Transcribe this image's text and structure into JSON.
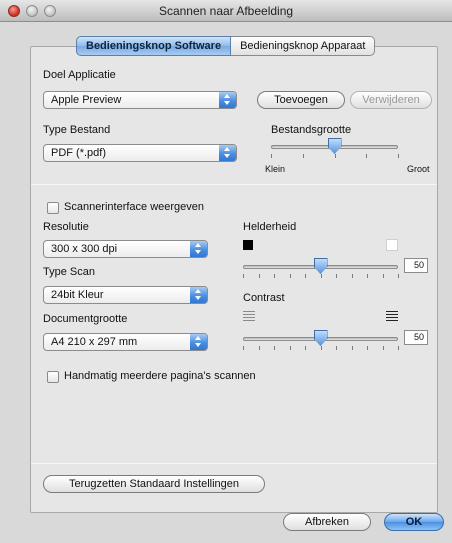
{
  "window": {
    "title": "Scannen naar Afbeelding"
  },
  "tabs": [
    {
      "label": "Bedieningsknop Software",
      "active": true
    },
    {
      "label": "Bedieningsknop Apparaat",
      "active": false
    }
  ],
  "doel": {
    "label": "Doel Applicatie",
    "value": "Apple Preview",
    "add_label": "Toevoegen",
    "remove_label": "Verwijderen"
  },
  "type_bestand": {
    "label": "Type Bestand",
    "value": "PDF (*.pdf)"
  },
  "bestandsgrootte": {
    "label": "Bestandsgrootte",
    "min_label": "Klein",
    "max_label": "Groot",
    "level": 0.5
  },
  "scannerinterface": {
    "label": "Scannerinterface weergeven",
    "checked": false
  },
  "resolutie": {
    "label": "Resolutie",
    "value": "300 x 300 dpi"
  },
  "type_scan": {
    "label": "Type Scan",
    "value": "24bit Kleur"
  },
  "documentgrootte": {
    "label": "Documentgrootte",
    "value": "A4  210 x 297 mm"
  },
  "helderheid": {
    "label": "Helderheid",
    "value": "50",
    "level": 0.5
  },
  "contrast": {
    "label": "Contrast",
    "value": "50",
    "level": 0.5
  },
  "handmatig": {
    "label": "Handmatig meerdere pagina's scannen",
    "checked": false
  },
  "reset": {
    "label": "Terugzetten Standaard Instellingen"
  },
  "footer": {
    "cancel_label": "Afbreken",
    "ok_label": "OK"
  },
  "colors": {
    "accent": "#4a8fe3",
    "panel": "#e6e6e6",
    "window": "#d9d9d9"
  }
}
